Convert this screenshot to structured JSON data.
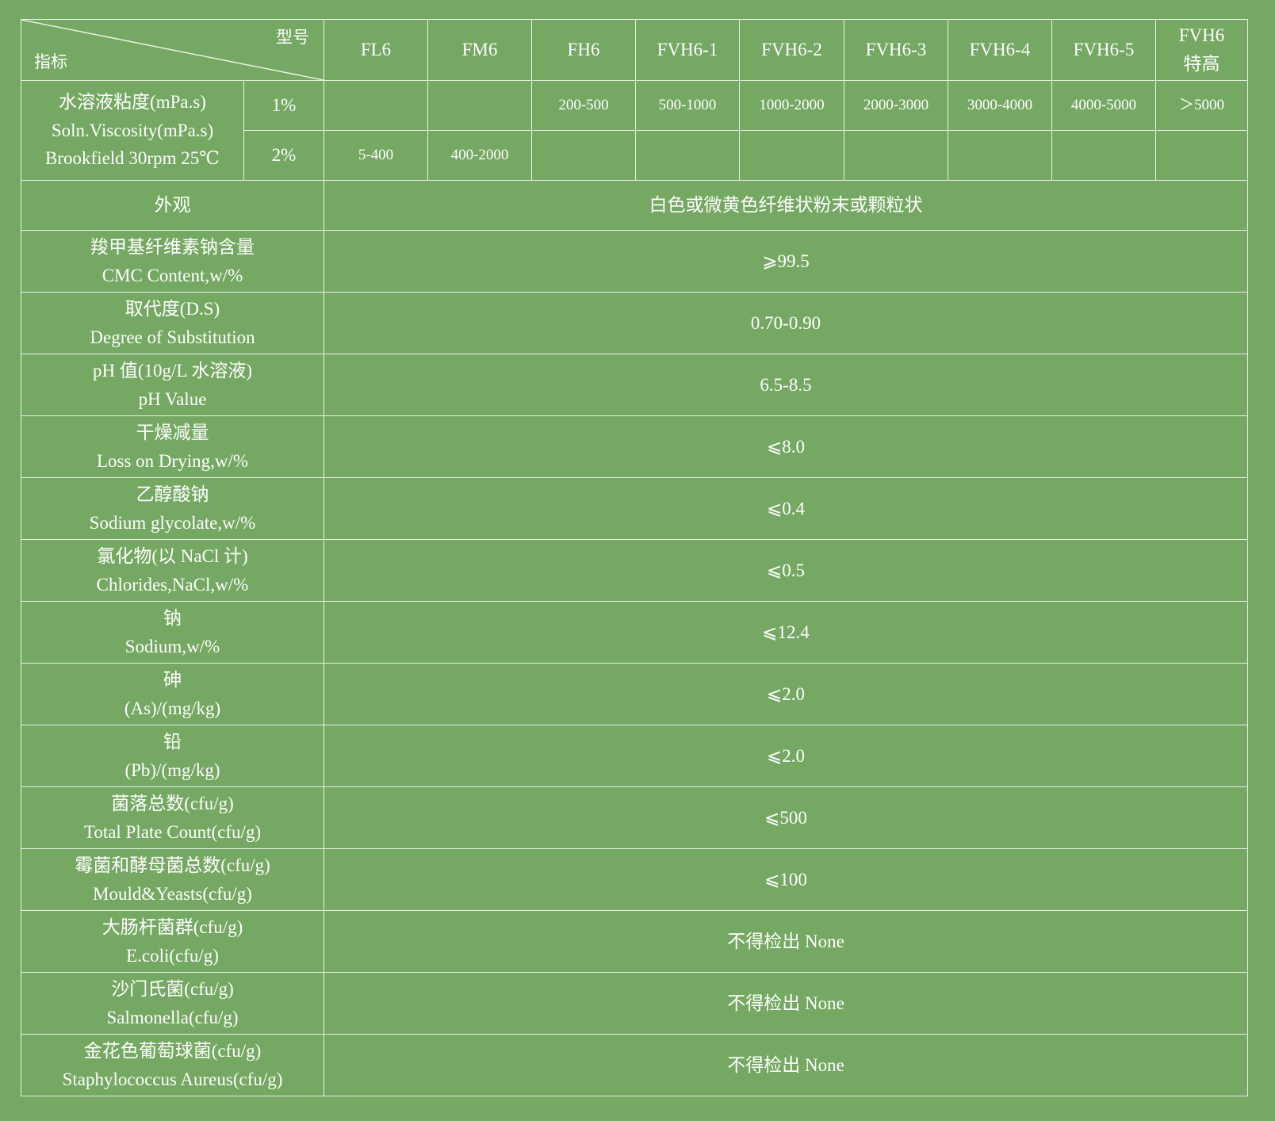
{
  "header": {
    "corner_model": "型号",
    "corner_index": "指标",
    "models": [
      "FL6",
      "FM6",
      "FH6",
      "FVH6-1",
      "FVH6-2",
      "FVH6-3",
      "FVH6-4",
      "FVH6-5"
    ],
    "last_model_line1": "FVH6",
    "last_model_line2": "特高"
  },
  "viscosity": {
    "label_cn": "水溶液粘度(mPa.s)",
    "label_en": "Soln.Viscosity(mPa.s)",
    "label_method": "Brookfield 30rpm 25℃",
    "rows": [
      {
        "concentration": "1%",
        "values": [
          "",
          "",
          "200-500",
          "500-1000",
          "1000-2000",
          "2000-3000",
          "3000-4000",
          "4000-5000",
          "＞5000"
        ]
      },
      {
        "concentration": "2%",
        "values": [
          "5-400",
          "400-2000",
          "",
          "",
          "",
          "",
          "",
          "",
          ""
        ]
      }
    ]
  },
  "appearance": {
    "label": "外观",
    "value": "白色或微黄色纤维状粉末或颗粒状"
  },
  "specs": [
    {
      "cn": "羧甲基纤维素钠含量",
      "en": "CMC Content,w/%",
      "value": "⩾99.5"
    },
    {
      "cn": "取代度(D.S)",
      "en": "Degree of Substitution",
      "value": "0.70-0.90"
    },
    {
      "cn": "pH 值(10g/L 水溶液)",
      "en": "pH Value",
      "value": "6.5-8.5"
    },
    {
      "cn": "干燥减量",
      "en": "Loss on Drying,w/%",
      "value": "⩽8.0"
    },
    {
      "cn": "乙醇酸钠",
      "en": "Sodium glycolate,w/%",
      "value": "⩽0.4"
    },
    {
      "cn": "氯化物(以 NaCl 计)",
      "en": "Chlorides,NaCl,w/%",
      "value": "⩽0.5"
    },
    {
      "cn": "钠",
      "en": "Sodium,w/%",
      "value": "⩽12.4"
    },
    {
      "cn": "砷",
      "en": "(As)/(mg/kg)",
      "value": "⩽2.0"
    },
    {
      "cn": "铅",
      "en": "(Pb)/(mg/kg)",
      "value": "⩽2.0"
    },
    {
      "cn": "菌落总数(cfu/g)",
      "en": "Total Plate Count(cfu/g)",
      "value": "⩽500"
    },
    {
      "cn": "霉菌和酵母菌总数(cfu/g)",
      "en": "Mould&Yeasts(cfu/g)",
      "value": "⩽100"
    },
    {
      "cn": "大肠杆菌群(cfu/g)",
      "en": "E.coli(cfu/g)",
      "value": "不得检出 None"
    },
    {
      "cn": "沙门氏菌(cfu/g)",
      "en": "Salmonella(cfu/g)",
      "value": "不得检出 None"
    },
    {
      "cn": "金花色葡萄球菌(cfu/g)",
      "en": "Staphylococcus Aureus(cfu/g)",
      "value": "不得检出 None"
    }
  ],
  "colors": {
    "background": "#75a862",
    "grid": "#e8f1e2",
    "text": "#ffffff"
  }
}
